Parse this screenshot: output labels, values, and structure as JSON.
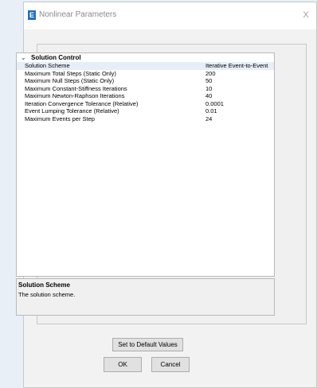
{
  "window": {
    "title": "Nonlinear Parameters",
    "icon_letter": "E",
    "close_glyph": "X"
  },
  "grid": {
    "category": {
      "label": "Solution Control",
      "toggle_glyph": "⌄"
    },
    "properties": [
      {
        "name": "Solution Scheme",
        "value": "Iterative Event-to-Event"
      },
      {
        "name": "Maximum Total Steps (Static Only)",
        "value": "200"
      },
      {
        "name": "Maximum Null Steps (Static Only)",
        "value": "50"
      },
      {
        "name": "Maximum Constant-Stiffness Iterations",
        "value": "10"
      },
      {
        "name": "Maximum Newton-Raphson Iterations",
        "value": "40"
      },
      {
        "name": "Iteration Convergence Tolerance (Relative)",
        "value": "0.0001"
      },
      {
        "name": "Event Lumping Tolerance (Relative)",
        "value": "0.01"
      },
      {
        "name": "Maximum Events per Step",
        "value": "24"
      }
    ]
  },
  "description": {
    "title": "Solution Scheme",
    "text": "The solution scheme."
  },
  "buttons": {
    "default_values": "Set to Default Values",
    "ok": "OK",
    "cancel": "Cancel"
  },
  "colors": {
    "accent": "#1f6fc5",
    "background": "#e9eff6",
    "dialog": "#f2f2f2"
  }
}
